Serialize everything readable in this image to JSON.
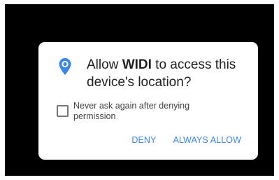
{
  "dialog": {
    "title_prefix": "Allow ",
    "app_name": "WIDI",
    "title_suffix": " to access this device's location?",
    "icon": "location-pin-icon",
    "checkbox": {
      "label": "Never ask again after denying permission",
      "checked": false
    },
    "buttons": {
      "deny_label": "DENY",
      "allow_label": "ALWAYS ALLOW"
    }
  },
  "colors": {
    "accent": "#3a87e6",
    "backdrop": "#000000",
    "dialog_bg": "#ffffff",
    "title_text": "#212121"
  }
}
